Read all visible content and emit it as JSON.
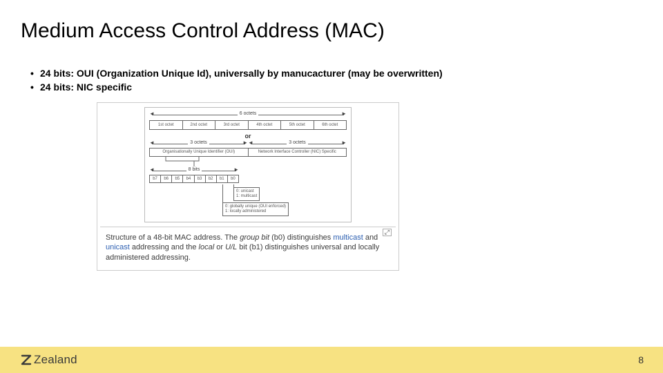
{
  "title": "Medium Access Control Address (MAC)",
  "bullets": [
    "24 bits: OUI (Organization Unique Id), universally by manucacturer (may be overwritten)",
    "24 bits: NIC specific"
  ],
  "diagram": {
    "top_arrow_label": "6 octets",
    "octets": [
      "1st octet",
      "2nd octet",
      "3rd octet",
      "4th octet",
      "5th octet",
      "6th octet"
    ],
    "or_text": "or",
    "left_arrow_label": "3 octets",
    "right_arrow_label": "3 octets",
    "half_left": "Organisationally Unique\nIdentifier (OUI)",
    "half_right": "Network Interface Controller\n(NIC) Specific",
    "bits_arrow_label": "8 bits",
    "bits": [
      "b7",
      "b6",
      "b5",
      "b4",
      "b3",
      "b2",
      "b1",
      "b0"
    ],
    "annot_b0_0": "0: unicast",
    "annot_b0_1": "1: multicast",
    "annot_b1_0": "0: globally unique (OUI enforced)",
    "annot_b1_1": "1: locally administered"
  },
  "caption": {
    "prefix": "Structure of a 48-bit MAC address. The ",
    "group_bit": "group bit",
    "mid1": " (b0) distinguishes ",
    "multicast": "multicast",
    "and1": " and ",
    "unicast": "unicast",
    "mid2": " addressing and the ",
    "local": "local",
    "or": " or ",
    "ul": "U/L",
    "mid3": " bit (b1) distinguishes universal and locally administered addressing.",
    "expand_icon": "⤢"
  },
  "footer": {
    "logo_text": "Zealand",
    "page_number": "8"
  }
}
